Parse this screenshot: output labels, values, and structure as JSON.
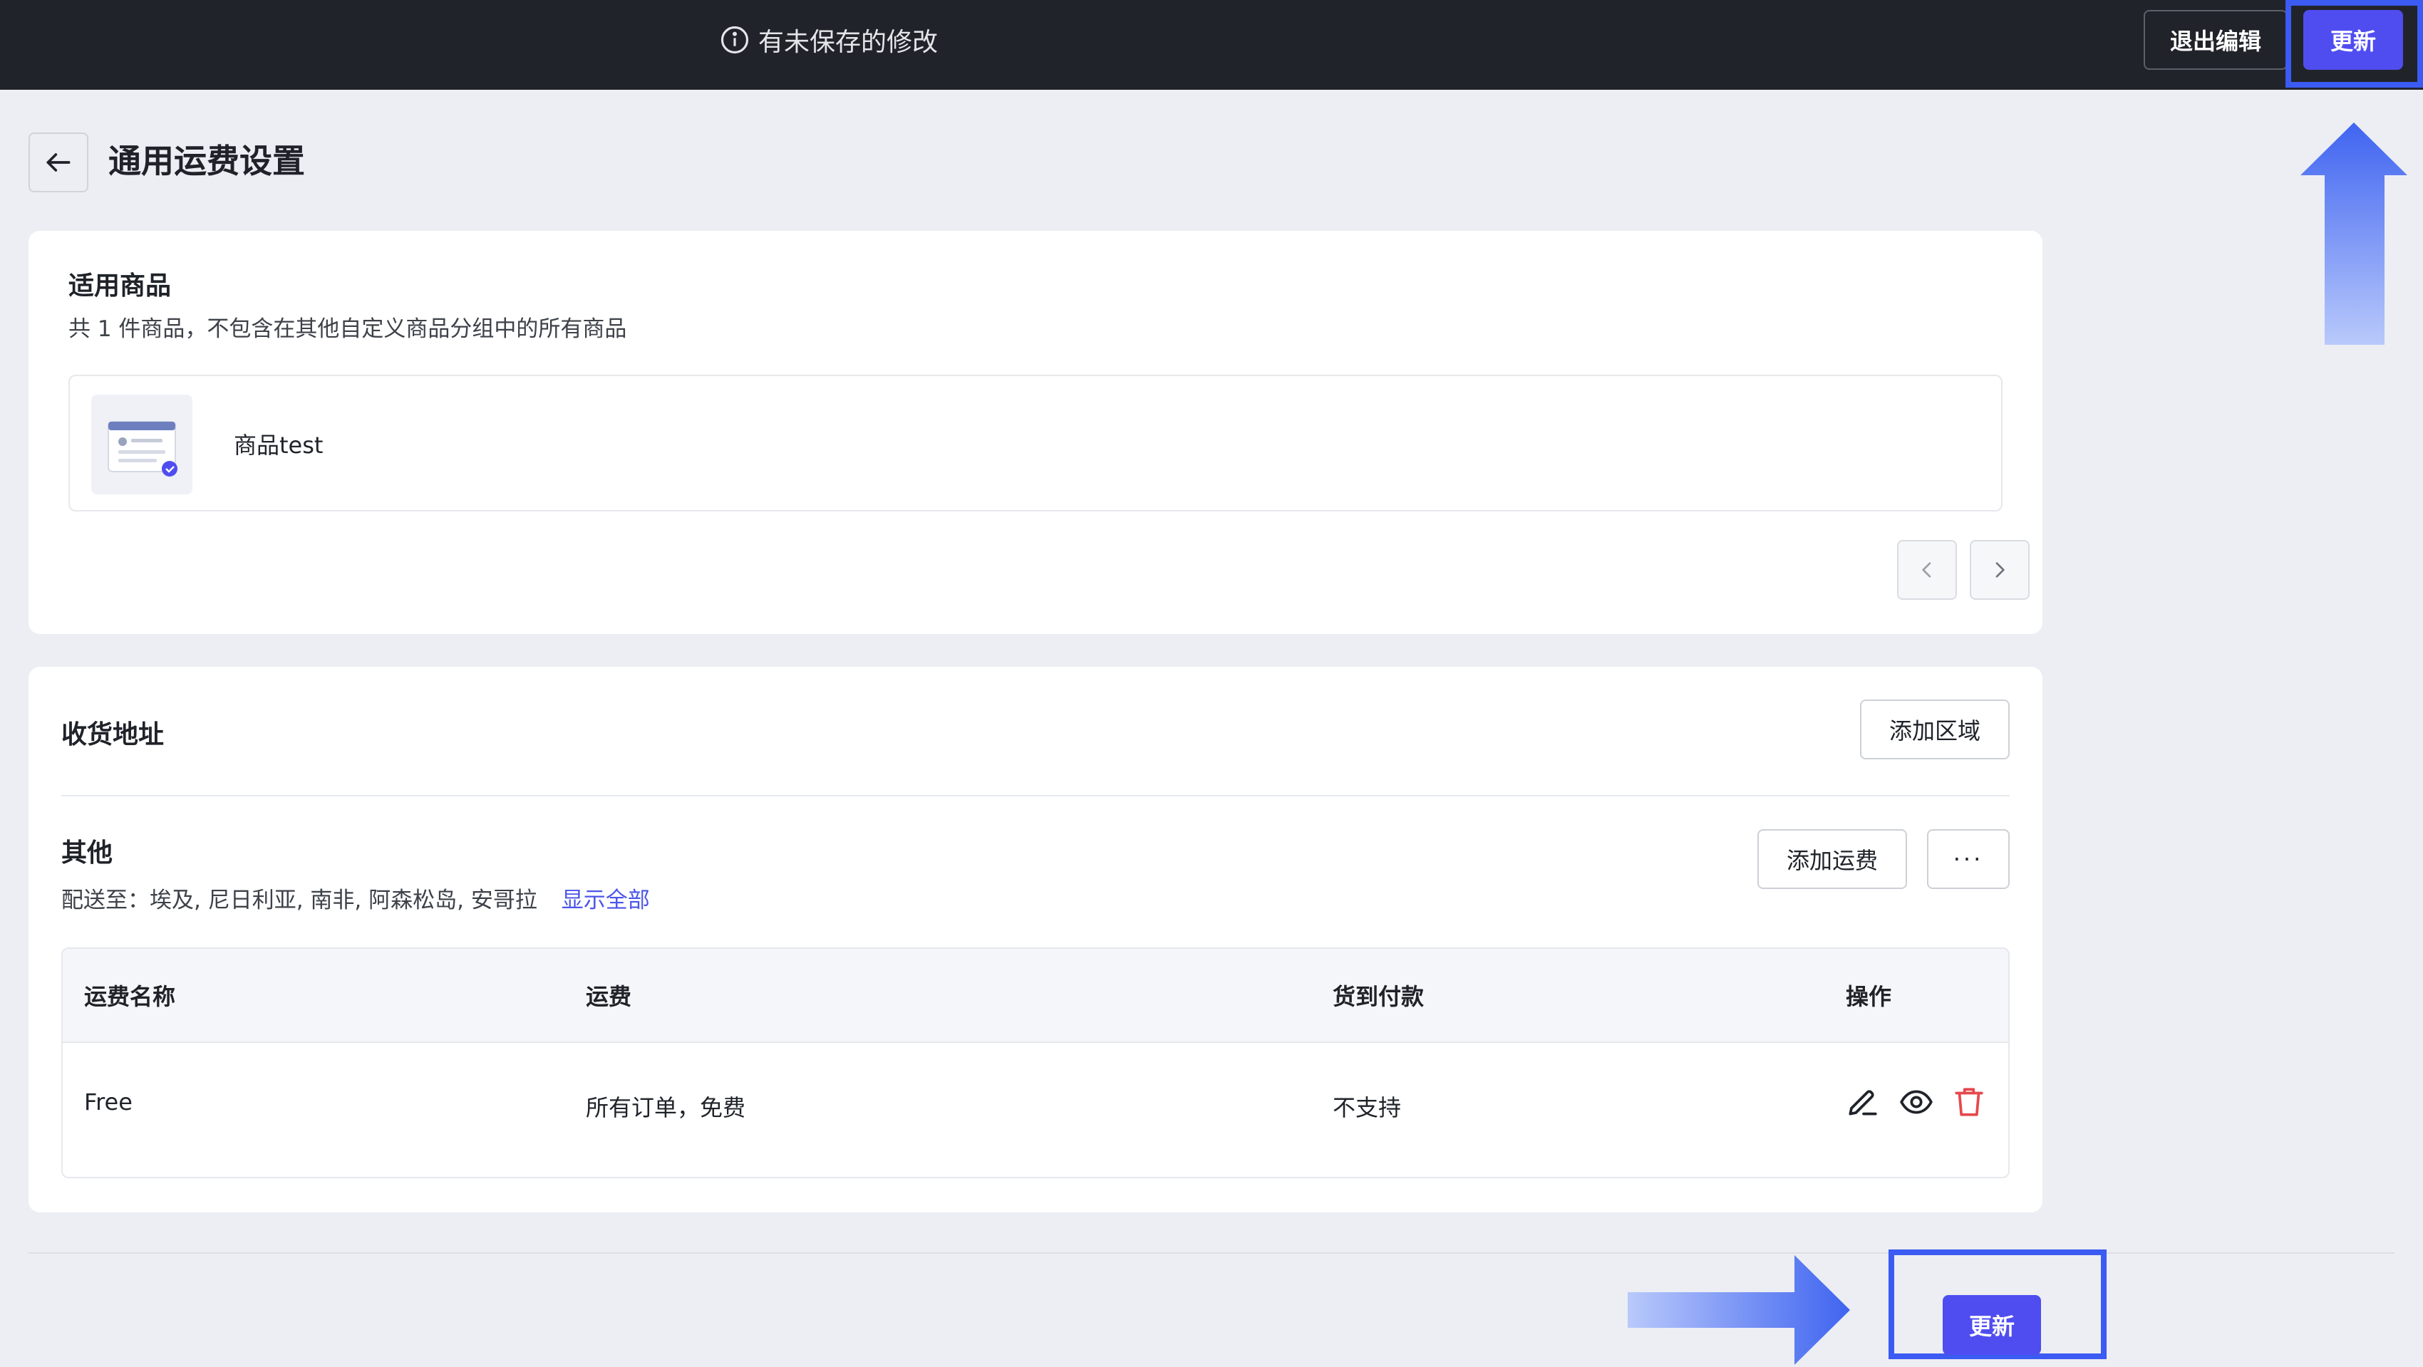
{
  "topbar": {
    "unsaved_text": "有未保存的修改",
    "exit_label": "退出编辑",
    "update_label": "更新"
  },
  "header": {
    "title": "通用运费设置"
  },
  "products": {
    "title": "适用商品",
    "description": "共 1 件商品，不包含在其他自定义商品分组中的所有商品",
    "items": [
      {
        "name": "商品test"
      }
    ]
  },
  "shipping": {
    "title": "收货地址",
    "add_region_label": "添加区域",
    "zone": {
      "name": "其他",
      "ship_to_prefix": "配送至：",
      "regions": "埃及, 尼日利亚, 南非, 阿森松岛, 安哥拉",
      "show_all_label": "显示全部",
      "add_rate_label": "添加运费",
      "more_label": "···"
    },
    "table": {
      "headers": [
        "运费名称",
        "运费",
        "货到付款",
        "操作"
      ],
      "rows": [
        {
          "name": "Free",
          "fee": "所有订单，免费",
          "cod": "不支持"
        }
      ]
    }
  },
  "footer": {
    "update_label": "更新"
  },
  "colors": {
    "accent": "#4f4df0",
    "topbar_bg": "#21232a",
    "highlight": "#3b5bf2",
    "delete": "#e5484d",
    "link": "#4b55e8"
  }
}
